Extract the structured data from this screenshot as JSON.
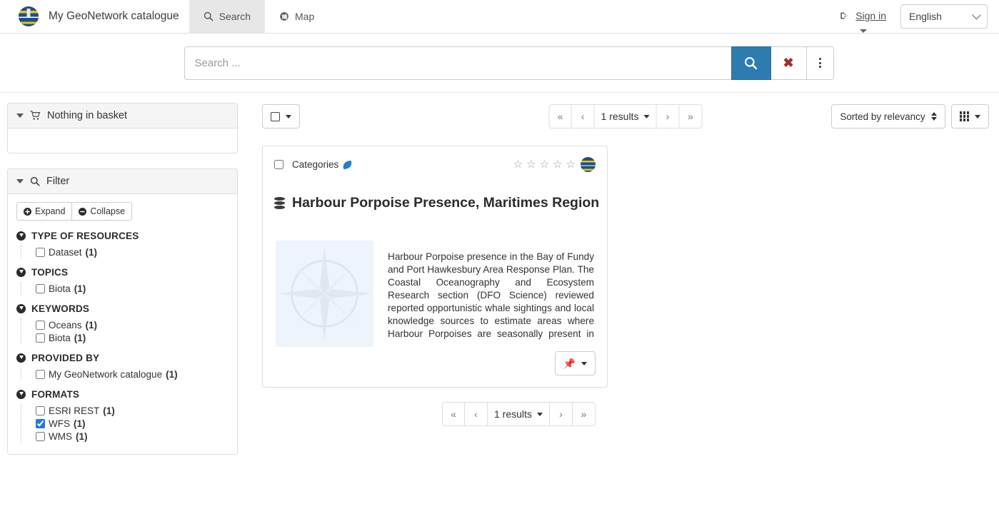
{
  "navbar": {
    "logo_icon": "geonetwork-globe-logo",
    "brand_title": "My GeoNetwork catalogue",
    "tabs": [
      {
        "label": "Search",
        "icon": "search-icon",
        "active": true
      },
      {
        "label": "Map",
        "icon": "globe-icon",
        "active": false
      }
    ],
    "signin_label": "Sign in",
    "signin_icon": "sign-in-icon",
    "language": {
      "selected": "English",
      "options": [
        "English"
      ]
    }
  },
  "search": {
    "placeholder": "Search ...",
    "value": "",
    "search_icon": "search-icon",
    "clear_icon": "times-icon",
    "more_icon": "ellipsis-vertical-icon"
  },
  "sidebar": {
    "basket": {
      "title": "Nothing in basket",
      "icon": "shopping-cart-icon"
    },
    "filter": {
      "title": "Filter",
      "icon": "search-icon",
      "expand_label": "Expand",
      "collapse_label": "Collapse",
      "expand_icon": "plus-circle-icon",
      "collapse_icon": "minus-circle-icon",
      "facets": [
        {
          "title": "TYPE OF RESOURCES",
          "items": [
            {
              "label": "Dataset",
              "count": "(1)",
              "checked": false
            }
          ]
        },
        {
          "title": "TOPICS",
          "items": [
            {
              "label": "Biota",
              "count": "(1)",
              "checked": false
            }
          ]
        },
        {
          "title": "KEYWORDS",
          "items": [
            {
              "label": "Oceans",
              "count": "(1)",
              "checked": false
            },
            {
              "label": "Biota",
              "count": "(1)",
              "checked": false
            }
          ]
        },
        {
          "title": "PROVIDED BY",
          "items": [
            {
              "label": "My GeoNetwork catalogue",
              "count": "(1)",
              "checked": false
            }
          ]
        },
        {
          "title": "FORMATS",
          "items": [
            {
              "label": "ESRI REST",
              "count": "(1)",
              "checked": false
            },
            {
              "label": "WFS",
              "count": "(1)",
              "checked": true
            },
            {
              "label": "WMS",
              "count": "(1)",
              "checked": false
            }
          ]
        }
      ]
    }
  },
  "results": {
    "select_all_icon": "checkbox-icon",
    "pagination": {
      "first_label": "«",
      "prev_label": "‹",
      "count_label": "1 results",
      "next_label": "›",
      "last_label": "»"
    },
    "sort": {
      "label": "Sorted by relevancy",
      "icon": "sort-updown-icon"
    },
    "view": {
      "icon": "grid-view-icon"
    },
    "cards": [
      {
        "categories_label": "Categories",
        "categories_icon": "leaf-icon",
        "rating": {
          "stars": 5,
          "filled": 0,
          "star_glyph": "☆"
        },
        "logo_icon": "geonetwork-globe-logo",
        "title": "Harbour Porpoise Presence, Maritimes Region",
        "title_icon": "database-icon",
        "thumbnail_icon": "compass-rose-placeholder",
        "description": "Harbour Porpoise presence in the Bay of Fundy and Port Hawkesbury Area Response Plan. The Coastal Oceanography and Ecosystem Research section (DFO Science) reviewed reported opportunistic whale sightings and local knowledge sources to estimate areas where Harbour Porpoises are seasonally present in the Bay of Fundy and Port Hawkesbury Area Response Plan areas.",
        "pin_icon": "thumbtack-icon"
      }
    ]
  },
  "colors": {
    "accent_blue": "#2c7cb0",
    "clear_red": "#a62b2b",
    "checkbox_blue": "#1f7ae0",
    "panel_head_bg": "#f5f5f5",
    "border": "#dddddd",
    "thumb_bg": "#eef4fb"
  }
}
